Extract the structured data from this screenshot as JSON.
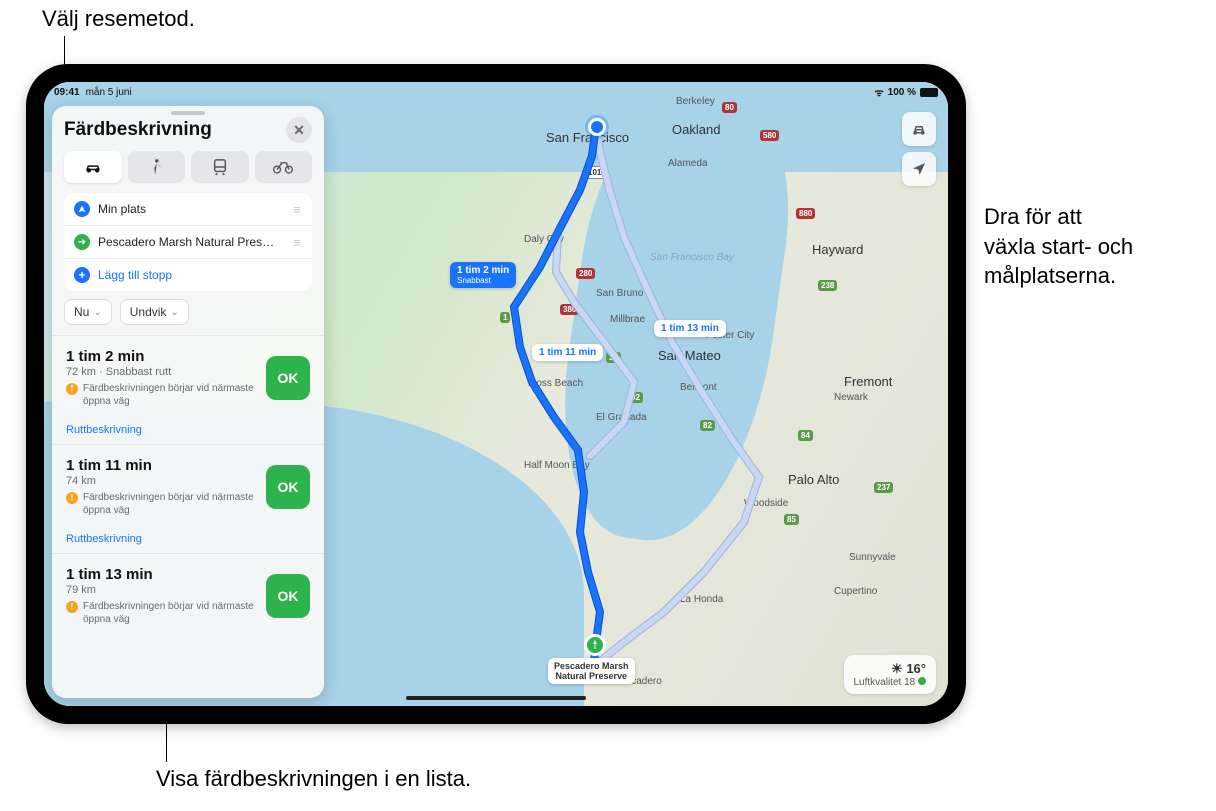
{
  "callouts": {
    "top": "Välj resemetod.",
    "right_l1": "Dra för att",
    "right_l2": "växla start- och",
    "right_l3": "målplatserna.",
    "bottom": "Visa färdbeskrivningen i en lista."
  },
  "status": {
    "time": "09:41",
    "date": "mån 5 juni",
    "battery": "100 %"
  },
  "panel": {
    "title": "Färdbeskrivning",
    "stops": {
      "origin": "Min plats",
      "destination": "Pescadero Marsh Natural Pres…",
      "add": "Lägg till stopp"
    },
    "options": {
      "now": "Nu",
      "avoid": "Undvik"
    },
    "routes": [
      {
        "time": "1 tim 2 min",
        "dist": "72 km · Snabbast rutt",
        "warn": "Färdbeskrivningen börjar vid närmaste öppna väg",
        "go": "OK",
        "steps": "Ruttbeskrivning"
      },
      {
        "time": "1 tim 11 min",
        "dist": "74 km",
        "warn": "Färdbeskrivningen börjar vid närmaste öppna väg",
        "go": "OK",
        "steps": "Ruttbeskrivning"
      },
      {
        "time": "1 tim 13 min",
        "dist": "79 km",
        "warn": "Färdbeskrivningen börjar vid närmaste öppna väg",
        "go": "OK",
        "steps": "Ruttbeskrivning"
      }
    ]
  },
  "map": {
    "labels": {
      "sf": "San Francisco",
      "oakland": "Oakland",
      "berkeley": "Berkeley",
      "alameda": "Alameda",
      "dalycity": "Daly City",
      "sanbruno": "San Bruno",
      "sanmateo": "San Mateo",
      "hayward": "Hayward",
      "fremont": "Fremont",
      "paloalto": "Palo Alto",
      "woodside": "Woodside",
      "halfmoon": "Half Moon Bay",
      "elgranada": "El Granada",
      "mossbeach": "Moss Beach",
      "pescadero": "Pescadero",
      "laHonda": "La Honda",
      "fostercity": "Foster City",
      "belmont": "Belmont",
      "millbrae": "Millbrae",
      "sunnyvale": "Sunnyvale",
      "cupertino": "Cupertino",
      "newark": "Newark",
      "sfbay": "San Francisco Bay",
      "dest": "Pescadero Marsh\nNatural Preserve"
    },
    "bubbles": {
      "b1": "1 tim 2 min",
      "b1s": "Snabbast",
      "b2": "1 tim 11 min",
      "b3": "1 tim 13 min"
    },
    "shields": {
      "i80": "80",
      "i580": "580",
      "i280": "280",
      "i380": "380",
      "i880": "880",
      "u101": "101",
      "c1": "1",
      "c35": "35",
      "c84": "84",
      "c85": "85",
      "c92": "92",
      "c82": "82",
      "c238": "238",
      "c237": "237"
    },
    "weather": {
      "icon": "☀",
      "temp": "16°",
      "air": "Luftkvalitet 18"
    }
  }
}
